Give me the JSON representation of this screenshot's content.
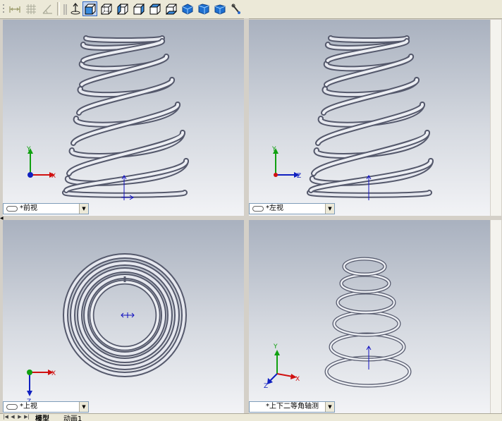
{
  "toolbar": {
    "buttons": [
      {
        "name": "dimension-icon",
        "active": false
      },
      {
        "name": "grid-icon",
        "active": false
      },
      {
        "name": "angle-icon",
        "active": false
      },
      {
        "name": "normal-to-icon",
        "active": false
      },
      {
        "name": "front-view-icon",
        "active": true
      },
      {
        "name": "back-view-icon",
        "active": false
      },
      {
        "name": "left-view-icon",
        "active": false
      },
      {
        "name": "right-view-icon",
        "active": false
      },
      {
        "name": "top-view-icon",
        "active": false
      },
      {
        "name": "bottom-view-icon",
        "active": false
      },
      {
        "name": "isometric-view-icon",
        "active": false
      },
      {
        "name": "trimetric-view-icon",
        "active": false
      },
      {
        "name": "dimetric-view-icon",
        "active": false
      },
      {
        "name": "link-views-icon",
        "active": false
      }
    ]
  },
  "viewports": {
    "front": {
      "label": "*前视",
      "axes": [
        "Y",
        "X"
      ]
    },
    "left": {
      "label": "*左视",
      "axes": [
        "Y",
        "Z"
      ]
    },
    "top": {
      "label": "*上视",
      "axes": [
        "X",
        "Z"
      ]
    },
    "dimetric": {
      "label": "*上下二等角轴测",
      "axes": [
        "Y",
        "X",
        "Z"
      ]
    }
  },
  "tabs": [
    {
      "label": "模型",
      "active": true
    },
    {
      "label": "动画1",
      "active": false
    }
  ],
  "colors": {
    "spring": "#8e93a6",
    "axis_x": "#d01010",
    "axis_y": "#10a010",
    "axis_z": "#1020c0",
    "origin": "#1010c0"
  }
}
